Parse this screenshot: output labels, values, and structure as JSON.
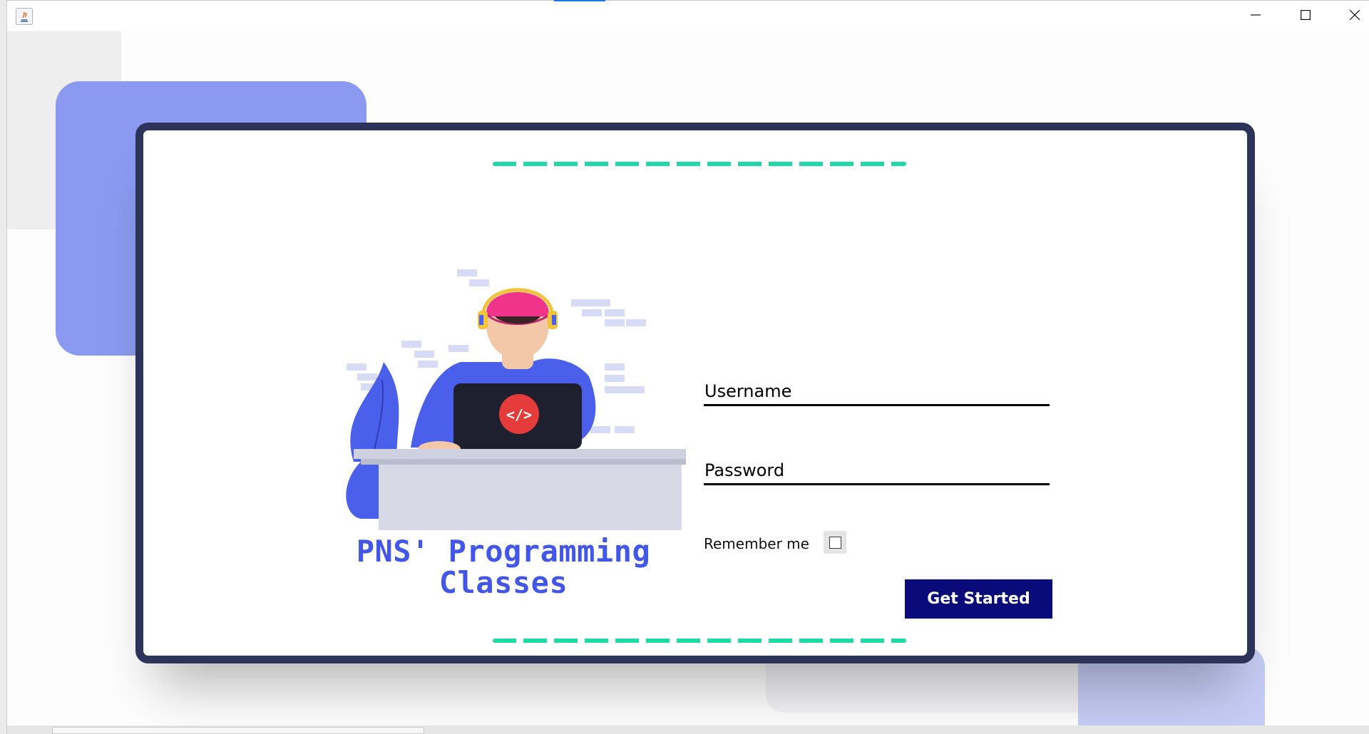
{
  "window": {
    "app_icon": "java-icon",
    "controls": {
      "minimize_icon": "minimize-icon",
      "maximize_icon": "maximize-icon",
      "close_icon": "close-icon"
    }
  },
  "branding": {
    "title": "PNS' Programming Classes",
    "title_line1": "PNS' Programming",
    "title_line2": "Classes",
    "illustration_icon": "developer-with-laptop-illustration",
    "code_badge": "</>"
  },
  "form": {
    "username": {
      "placeholder": "Username",
      "value": ""
    },
    "password": {
      "placeholder": "Password",
      "value": ""
    },
    "remember_label": "Remember me",
    "remember_checked": false,
    "submit_label": "Get Started"
  },
  "colors": {
    "card_border": "#2c3459",
    "accent_dashes": "#1fdaa6",
    "button_bg": "#0a0a7a",
    "brand_text": "#4257e8",
    "decor_blue": "#8b9af0"
  }
}
